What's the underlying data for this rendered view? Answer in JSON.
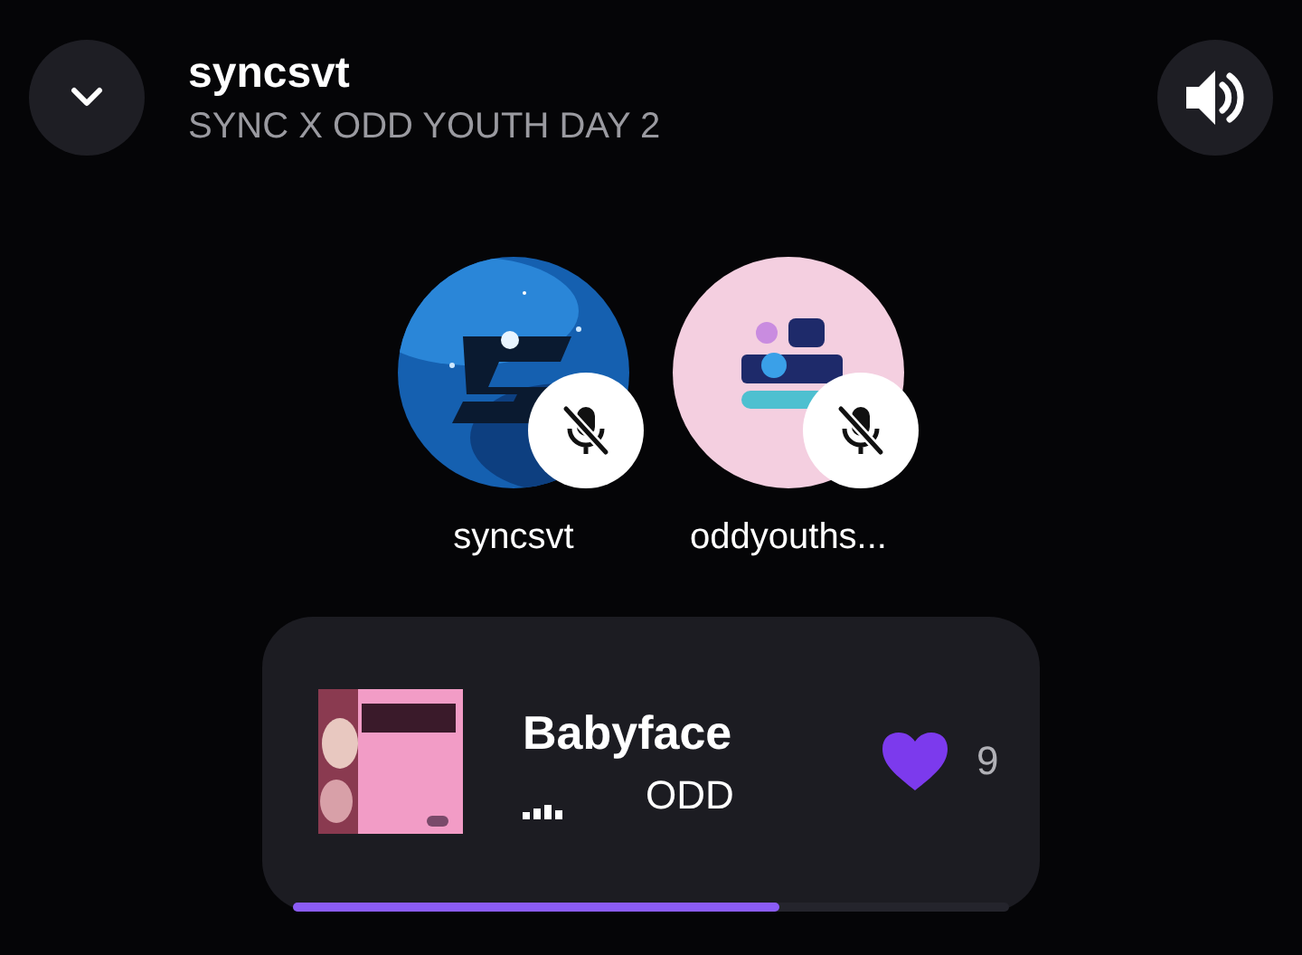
{
  "header": {
    "title": "syncsvt",
    "subtitle": "SYNC X ODD YOUTH DAY 2"
  },
  "participants": [
    {
      "name": "syncsvt",
      "muted": true,
      "kind": "picture"
    },
    {
      "name": "oddyouths...",
      "muted": true,
      "kind": "picture"
    }
  ],
  "now_playing": {
    "title": "Babyface",
    "subtitle": "ODD",
    "liked": true,
    "likes": "9",
    "level": 0.68
  }
}
